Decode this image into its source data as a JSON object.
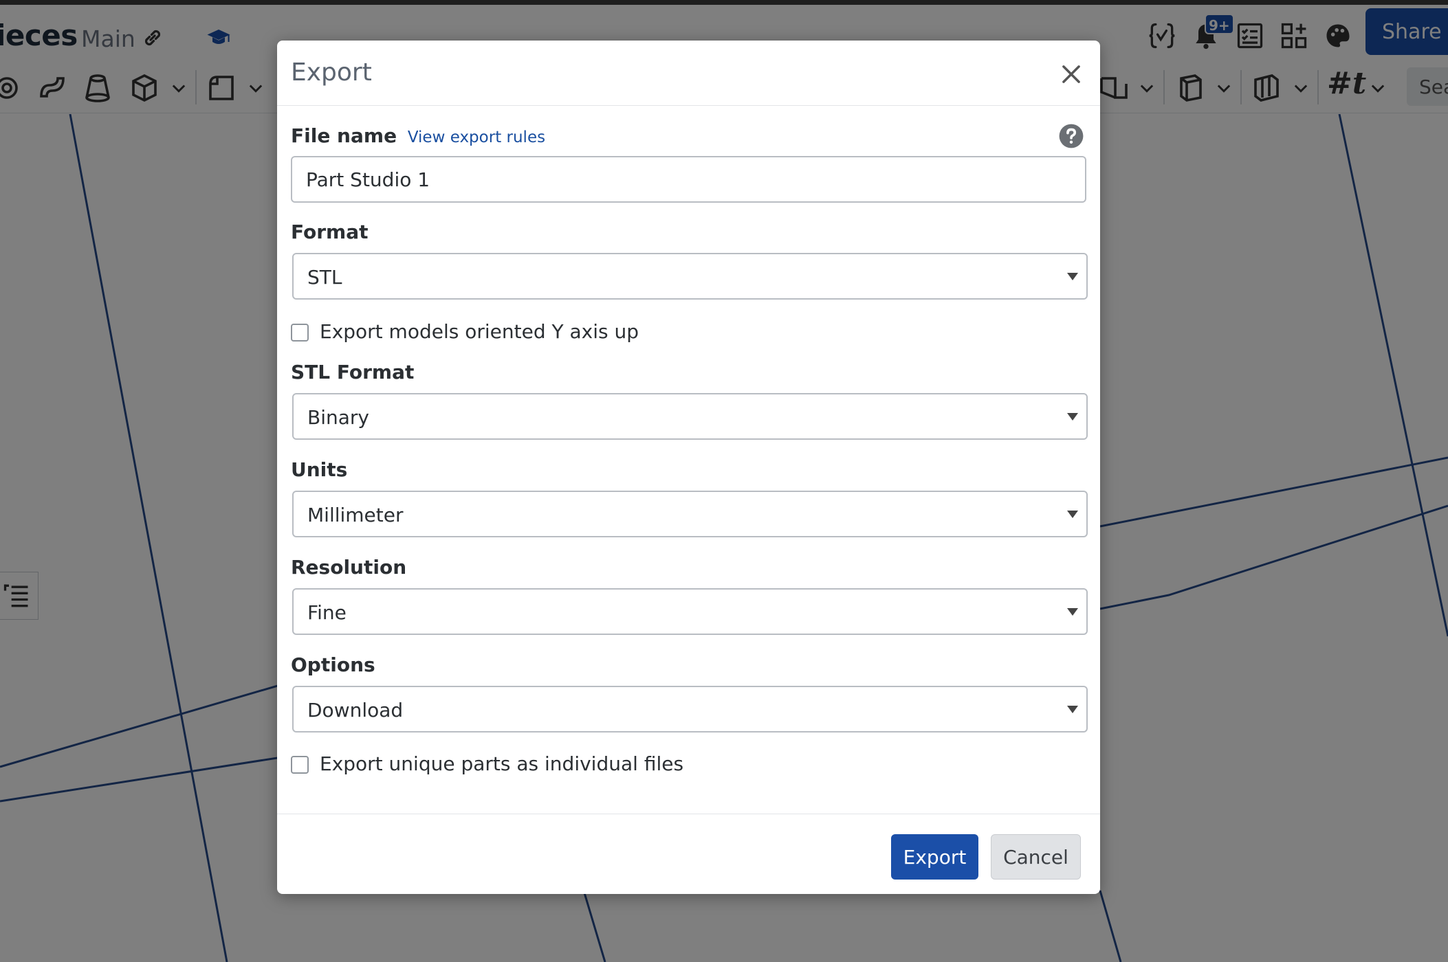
{
  "app": {
    "doc_title": "ieces",
    "branch": "Main",
    "share_label": "Share",
    "notifications_badge": "9+",
    "search_placeholder": "Sea",
    "hash_tool": "#t",
    "accent_color": "#1b4fa8"
  },
  "header_icons": [
    "link-icon",
    "graduation-cap-icon",
    "variables-icon",
    "notifications-icon",
    "checklist-icon",
    "apps-icon",
    "appearance-icon"
  ],
  "toolbar_icons": [
    "revolve-icon",
    "sweep-icon",
    "loft-icon",
    "extrude-icon",
    "fillet-icon",
    "sheet-metal-icon",
    "frame-icon",
    "surface-icon"
  ],
  "dialog": {
    "title": "Export",
    "file_name": {
      "label": "File name",
      "rules_link": "View export rules",
      "value": "Part Studio 1"
    },
    "format": {
      "label": "Format",
      "value": "STL"
    },
    "y_axis_up": {
      "label": "Export models oriented Y axis up",
      "checked": false
    },
    "stl_format": {
      "label": "STL Format",
      "value": "Binary"
    },
    "units": {
      "label": "Units",
      "value": "Millimeter"
    },
    "resolution": {
      "label": "Resolution",
      "value": "Fine"
    },
    "options": {
      "label": "Options",
      "value": "Download"
    },
    "unique_parts": {
      "label": "Export unique parts as individual files",
      "checked": false
    },
    "export_label": "Export",
    "cancel_label": "Cancel"
  }
}
